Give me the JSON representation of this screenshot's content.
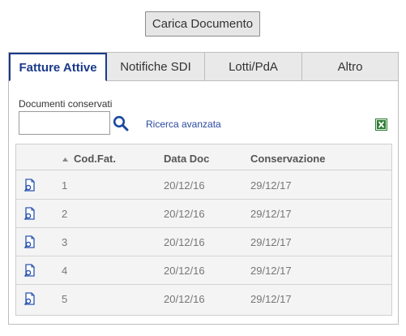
{
  "actions": {
    "upload_label": "Carica Documento"
  },
  "tabs": [
    {
      "label": "Fatture Attive",
      "active": true
    },
    {
      "label": "Notifiche SDI",
      "active": false
    },
    {
      "label": "Lotti/PdA",
      "active": false
    },
    {
      "label": "Altro",
      "active": false
    }
  ],
  "filter": {
    "label": "Documenti conservati",
    "value": "",
    "advanced_search_label": "Ricerca avanzata"
  },
  "icons": {
    "search": "search-icon",
    "export": "excel-export-icon",
    "sort": "sort-ascending-icon",
    "row_action": "document-view-icon"
  },
  "colors": {
    "accent": "#1a3a8a",
    "link": "#2a4aa0",
    "excel": "#2e7d32"
  },
  "table": {
    "columns": [
      "Cod.Fat.",
      "Data Doc",
      "Conservazione"
    ],
    "rows": [
      [
        "1",
        "20/12/16",
        "29/12/17"
      ],
      [
        "2",
        "20/12/16",
        "29/12/17"
      ],
      [
        "3",
        "20/12/16",
        "29/12/17"
      ],
      [
        "4",
        "20/12/16",
        "29/12/17"
      ],
      [
        "5",
        "20/12/16",
        "29/12/17"
      ]
    ]
  }
}
